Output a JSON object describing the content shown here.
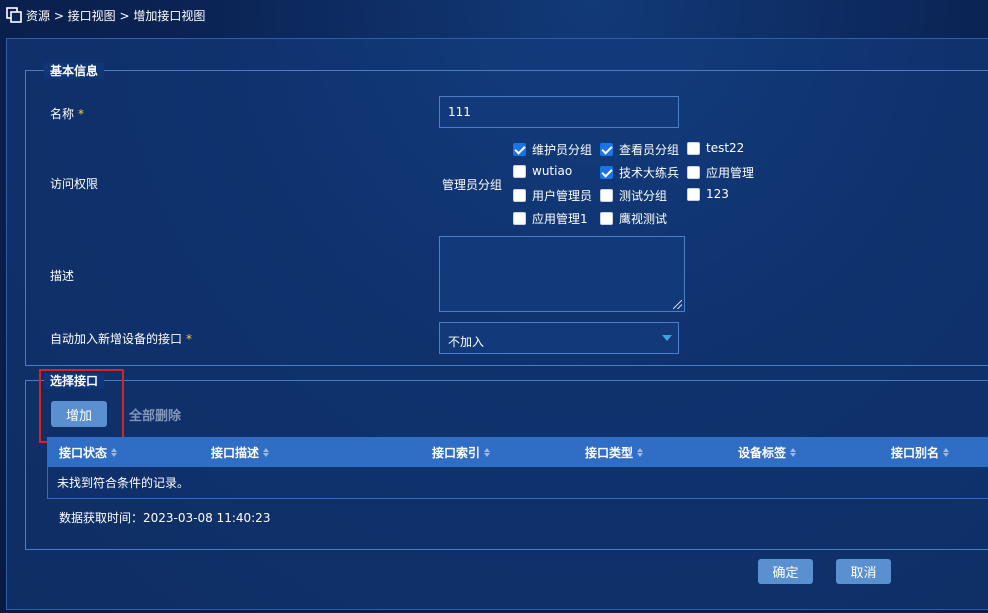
{
  "breadcrumb": {
    "icon": "resource-windows-icon",
    "path": "资源 > 接口视图 > 增加接口视图"
  },
  "basic_info": {
    "title": "基本信息",
    "name_label": "名称",
    "required_mark": "*",
    "name_value": "111",
    "access_label": "访问权限",
    "admin_group_label": "管理员分组",
    "groups": [
      {
        "label": "维护员分组",
        "checked": true
      },
      {
        "label": "查看员分组",
        "checked": true
      },
      {
        "label": "test22",
        "checked": false
      },
      {
        "label": "wutiao",
        "checked": false
      },
      {
        "label": "技术大练兵",
        "checked": true
      },
      {
        "label": "应用管理",
        "checked": false
      },
      {
        "label": "用户管理员",
        "checked": false
      },
      {
        "label": "测试分组",
        "checked": false
      },
      {
        "label": "123",
        "checked": false
      },
      {
        "label": "应用管理1",
        "checked": false
      },
      {
        "label": "鹰视测试",
        "checked": false
      }
    ],
    "description_label": "描述",
    "description_value": "",
    "auto_join_label": "自动加入新增设备的接口",
    "auto_join_value": "不加入"
  },
  "select_interface": {
    "title": "选择接口",
    "add_button": "增加",
    "delete_all_button": "全部删除",
    "columns": [
      "接口状态",
      "接口描述",
      "接口索引",
      "接口类型",
      "设备标签",
      "接口别名"
    ],
    "empty_text": "未找到符合条件的记录。",
    "fetch_time": "数据获取时间：2023-03-08 11:40:23"
  },
  "footer": {
    "confirm": "确定",
    "cancel": "取消"
  },
  "colors": {
    "background": "#0b2456",
    "table_header": "#2f6ec4",
    "primary_button": "#5a8fd0",
    "highlight_border": "#e0201e",
    "required_mark": "#ffcc33"
  }
}
